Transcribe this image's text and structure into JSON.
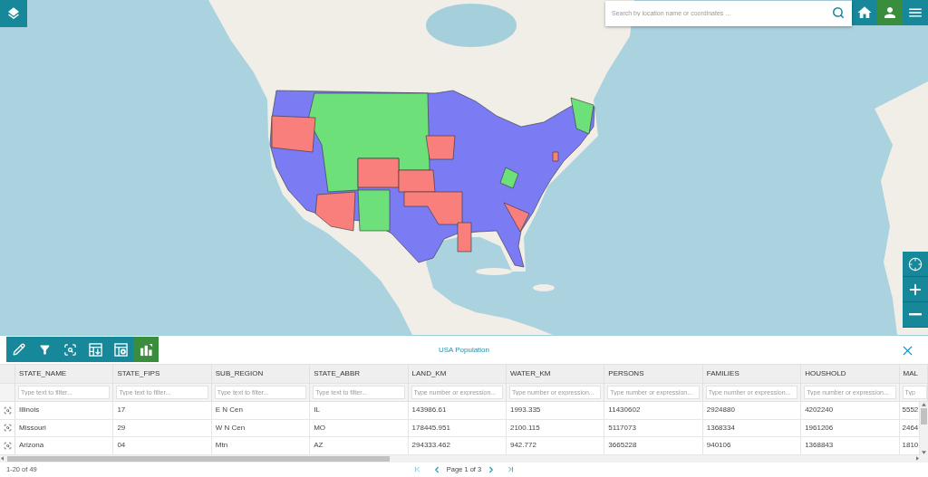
{
  "search": {
    "placeholder": "Search by location name or coordinates ..."
  },
  "top_buttons": [
    {
      "kind": "home",
      "active": false
    },
    {
      "kind": "user",
      "active": true
    },
    {
      "kind": "menu",
      "active": false
    }
  ],
  "map_controls": [
    {
      "kind": "locate"
    },
    {
      "kind": "zoom_in"
    },
    {
      "kind": "zoom_out"
    }
  ],
  "panel": {
    "title": "USA Population",
    "toolbar": [
      {
        "kind": "edit",
        "active": false
      },
      {
        "kind": "filter",
        "active": false
      },
      {
        "kind": "zoom_to_selection",
        "active": false
      },
      {
        "kind": "export",
        "active": false
      },
      {
        "kind": "table_settings",
        "active": false
      },
      {
        "kind": "chart",
        "active": true
      }
    ]
  },
  "table": {
    "columns": [
      {
        "name": "STATE_NAME",
        "placeholder": "Type text to filter..."
      },
      {
        "name": "STATE_FIPS",
        "placeholder": "Type text to filter..."
      },
      {
        "name": "SUB_REGION",
        "placeholder": "Type text to filter..."
      },
      {
        "name": "STATE_ABBR",
        "placeholder": "Type text to filter..."
      },
      {
        "name": "LAND_KM",
        "placeholder": "Type number or expression..."
      },
      {
        "name": "WATER_KM",
        "placeholder": "Type number or expression..."
      },
      {
        "name": "PERSONS",
        "placeholder": "Type number or expression..."
      },
      {
        "name": "FAMILIES",
        "placeholder": "Type number or expression..."
      },
      {
        "name": "HOUSHOLD",
        "placeholder": "Type number or expression..."
      },
      {
        "name": "MAL",
        "placeholder": "Typ"
      }
    ],
    "rows": [
      {
        "cells": [
          "Illinois",
          "17",
          "E N Cen",
          "IL",
          "143986.61",
          "1993.335",
          "11430602",
          "2924880",
          "4202240",
          "5552"
        ]
      },
      {
        "cells": [
          "Missouri",
          "29",
          "W N Cen",
          "MO",
          "178445.951",
          "2100.115",
          "5117073",
          "1368334",
          "1961206",
          "2464"
        ]
      },
      {
        "cells": [
          "Arizona",
          "04",
          "Mtn",
          "AZ",
          "294333.462",
          "942.772",
          "3665228",
          "940106",
          "1368843",
          "1810"
        ]
      }
    ]
  },
  "footer": {
    "count": "1-20 of 49",
    "page": "Page 1 of 3"
  }
}
